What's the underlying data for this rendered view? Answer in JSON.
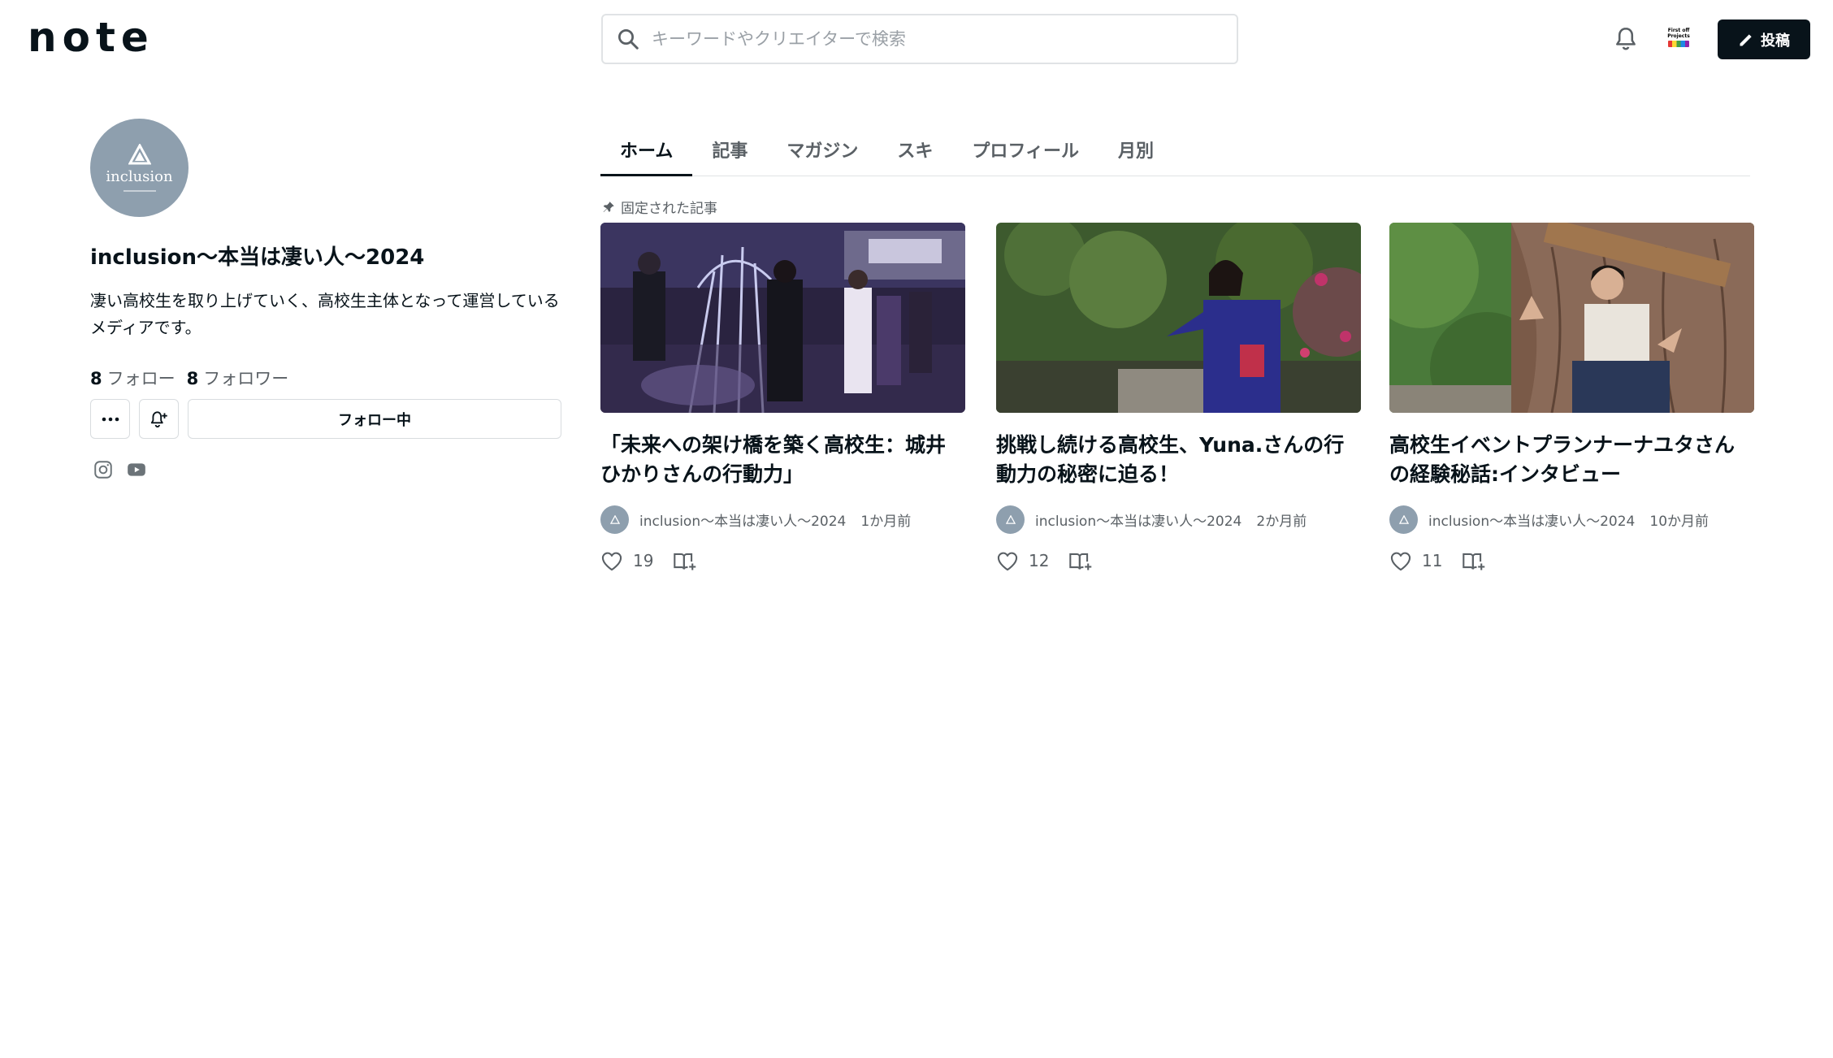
{
  "header": {
    "logo_text": "note",
    "search": {
      "placeholder": "キーワードやクリエイターで検索"
    },
    "post_label": "投稿",
    "account_badge_text": "First off Projects"
  },
  "profile": {
    "avatar_text": "inclusion",
    "name": "inclusion〜本当は凄い人〜2024",
    "bio": "凄い高校生を取り上げていく、高校生主体となって運営しているメディアです。",
    "following_count": "8",
    "following_label": "フォロー",
    "followers_count": "8",
    "followers_label": "フォロワー",
    "follow_button_label": "フォロー中"
  },
  "tabs": [
    {
      "label": "ホーム",
      "active": true
    },
    {
      "label": "記事"
    },
    {
      "label": "マガジン"
    },
    {
      "label": "スキ"
    },
    {
      "label": "プロフィール"
    },
    {
      "label": "月別"
    }
  ],
  "pinned_label": "固定された記事",
  "articles": [
    {
      "title": "「未来への架け橋を築く高校生：城井ひかりさんの行動力」",
      "author": "inclusion〜本当は凄い人〜2024",
      "time": "1か月前",
      "likes": "19"
    },
    {
      "title": "挑戦し続ける高校生、Yuna.さんの行動力の秘密に迫る！",
      "author": "inclusion〜本当は凄い人〜2024",
      "time": "2か月前",
      "likes": "12"
    },
    {
      "title": "高校生イベントプランナーナユタさんの経験秘話:インタビュー",
      "author": "inclusion〜本当は凄い人〜2024",
      "time": "10か月前",
      "likes": "11"
    }
  ],
  "colors": {
    "text": "#08131a",
    "muted": "#5a6065",
    "avatar_bg": "#8e9fae",
    "post_button_bg": "#08131a",
    "border": "#e0e3e5"
  }
}
